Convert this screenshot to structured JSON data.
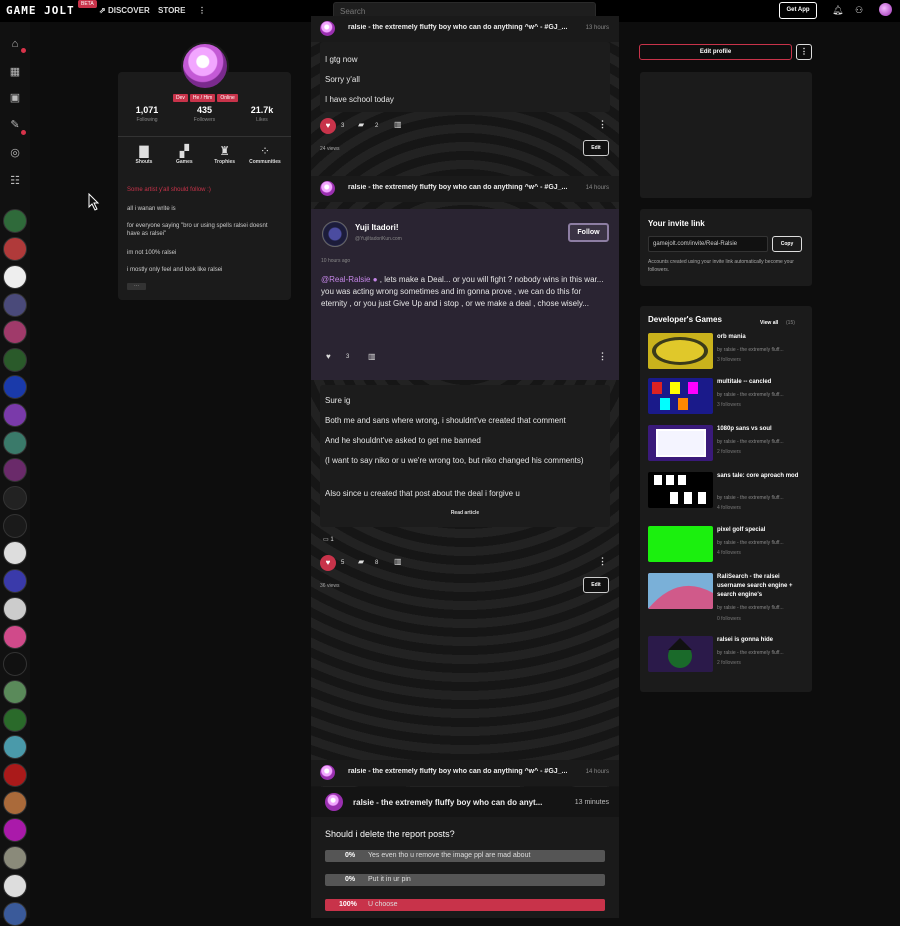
{
  "topbar": {
    "logo": "GAME JOLT",
    "logo_badge": "BETA",
    "nav": [
      "DISCOVER",
      "STORE"
    ],
    "more": "⋮",
    "search_placeholder": "Search",
    "get_app": "Get App"
  },
  "profile": {
    "badges": [
      "Dev",
      "He / Him",
      "Online"
    ],
    "stats": [
      {
        "num": "1,071",
        "label": "Following"
      },
      {
        "num": "435",
        "label": "Followers"
      },
      {
        "num": "21.7k",
        "label": "Likes"
      }
    ],
    "tabs": [
      "Shouts",
      "Games",
      "Trophies",
      "Communities"
    ],
    "bio_title": "Some artist y'all should follow :)",
    "bio_lines": [
      "all i wanan write is",
      "for everyone saying \"bro ur using spells ralsei doesnt have as ralsei\"",
      "im not 100% ralsei",
      "i mostly only feel and look like ralsei"
    ],
    "bio_more": "···"
  },
  "posts": [
    {
      "author": "ralsie - the extremely fluffy boy who can do anything ^w^ - #GJ_...",
      "time": "13 hours",
      "lines": [
        "I gtg now",
        "Sorry y'all",
        "I have school today"
      ],
      "likes": "3",
      "comments": "2",
      "views": "24 views",
      "edit": "Edit"
    },
    {
      "author": "ralsie - the extremely fluffy boy who can do anything ^w^ - #GJ_...",
      "time": "14 hours",
      "embed": {
        "name": "Yuji Itadori!",
        "handle": "@YujiItadoriKun.com",
        "follow": "Follow",
        "time": "10 hours ago",
        "mention": "@Real-Ralsie",
        "text": " , lets make a Deal... or you will fight ? nobody wins in this war...  you was acting wrong sometimes and im gonna prove , we can do this for eternity , or you just Give Up and i stop , or we make a deal , chose wisely...",
        "likes": "3"
      },
      "lines": [
        "Sure ig",
        "Both me and sans where wrong, i shouldnt've created that comment",
        "And he shouldnt've asked to get me banned",
        "(I want to say niko or u we're wrong too, but niko changed his comments)",
        "Also since u created that post about the deal i forgive u"
      ],
      "read_article": "Read article",
      "gift_count": "1",
      "likes": "5",
      "comments": "8",
      "views": "36 views",
      "edit": "Edit"
    },
    {
      "author": "ralsie - the extremely fluffy boy who can do anything ^w^ - #GJ_...",
      "time": "14 hours",
      "poll_author": "ralsie - the extremely fluffy boy who can do anyt...",
      "poll_time": "13 minutes",
      "poll_question": "Should i delete the report posts?",
      "poll_options": [
        {
          "pct": "0%",
          "label": "Yes even tho u remove the image ppl are mad about",
          "value": 0
        },
        {
          "pct": "0%",
          "label": "Put it in ur pin",
          "value": 0
        },
        {
          "pct": "100%",
          "label": "U choose",
          "value": 100
        }
      ]
    }
  ],
  "sidebar": {
    "edit_profile": "Edit profile",
    "invite_title": "Your invite link",
    "invite_link": "gamejolt.com/invite/Real-Ralsie",
    "copy": "Copy",
    "invite_note": "Accounts created using your invite link automatically become your followers.",
    "dev_title": "Developer's Games",
    "view_all": "View all",
    "view_count": "(15)",
    "games": [
      {
        "title": "orb mania",
        "by": "by ralsie - the extremely fluff...",
        "followers": "3 followers",
        "thumb": "#c9b21c"
      },
      {
        "title": "multitale -- cancled",
        "by": "by ralsie - the extremely fluff...",
        "followers": "3 followers",
        "thumb": "#1a1a8a"
      },
      {
        "title": "1080p sans vs soul",
        "by": "by ralsie - the extremely fluff...",
        "followers": "2 followers",
        "thumb": "#3a1a7a"
      },
      {
        "title": "sans tale: core aproach mod",
        "by": "by ralsie - the extremely fluff...",
        "followers": "4 followers",
        "thumb": "#000000"
      },
      {
        "title": "pixel golf special",
        "by": "by ralsie - the extremely fluff...",
        "followers": "4 followers",
        "thumb": "#1bf00e"
      },
      {
        "title": "RaliSearch - the ralsei username search engine + search engine's",
        "by": "by ralsie - the extremely fluff...",
        "followers": "0 followers",
        "thumb": "#c05a9a"
      },
      {
        "title": "ralsei is gonna hide",
        "by": "by ralsie - the extremely fluff...",
        "followers": "2 followers",
        "thumb": "#2b1a4a"
      }
    ]
  },
  "colors": {
    "accent": "#c8334a",
    "bg": "#0d0d0d",
    "card": "#1b1b1b"
  }
}
